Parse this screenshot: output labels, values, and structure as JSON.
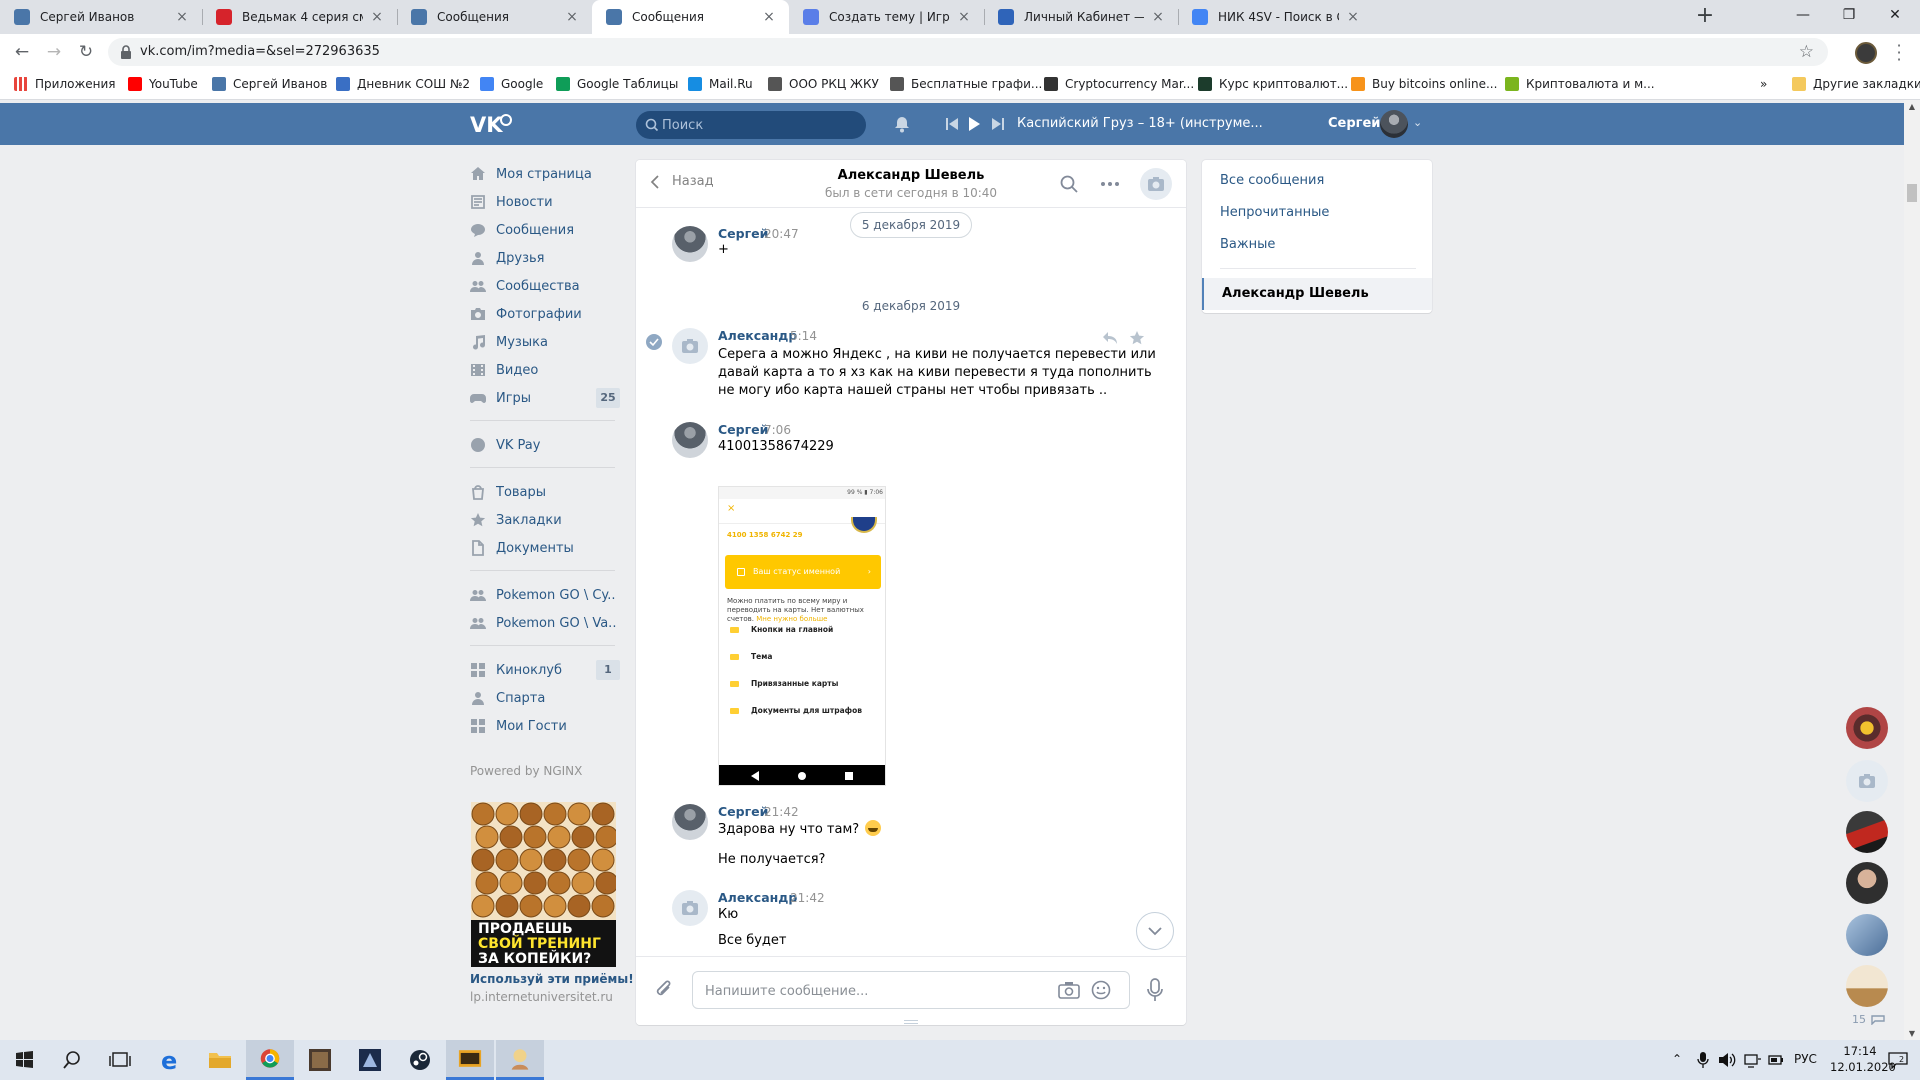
{
  "browser": {
    "tabs": [
      {
        "title": "Сергей Иванов",
        "icon": "vk-icon",
        "color": "#4a76a8"
      },
      {
        "title": "Ведьмак 4 серия смотреть онла",
        "icon": "z-icon",
        "color": "#d6232b"
      },
      {
        "title": "Сообщения",
        "icon": "vk-message-icon",
        "color": "#4a76a8"
      },
      {
        "title": "Сообщения",
        "icon": "vk-message-icon",
        "color": "#4a76a8"
      },
      {
        "title": "Создать тему | Игровое сообще",
        "icon": "s-icon",
        "color": "#5a7ee8"
      },
      {
        "title": "Личный Кабинет — «Скрайд»",
        "icon": "skrayd-icon",
        "color": "#2f64b9"
      },
      {
        "title": "НИК 4SV - Поиск в Google",
        "icon": "google-icon",
        "color": "#4285f4"
      }
    ],
    "active_tab": 3,
    "url": "vk.com/im?media=&sel=272963635",
    "bookmarks": [
      {
        "label": "Приложения",
        "color": "#e8453c"
      },
      {
        "label": "YouTube",
        "color": "#ff0000"
      },
      {
        "label": "Сергей Иванов",
        "color": "#4a76a8"
      },
      {
        "label": "Дневник СОШ №2",
        "color": "#3a6fc4"
      },
      {
        "label": "Google",
        "color": "#4285f4"
      },
      {
        "label": "Google Таблицы",
        "color": "#0f9d58"
      },
      {
        "label": "Mail.Ru",
        "color": "#168de2"
      },
      {
        "label": "ООО РКЦ ЖКУ",
        "color": "#555555"
      },
      {
        "label": "Бесплатные графи...",
        "color": "#555555"
      },
      {
        "label": "Cryptocurrency Mar...",
        "color": "#333333"
      },
      {
        "label": "Курс криптовалют...",
        "color": "#1c3c2c"
      },
      {
        "label": "Buy bitcoins online...",
        "color": "#f7931a"
      },
      {
        "label": "Криптовалюта и м...",
        "color": "#7bb51e"
      }
    ],
    "bookmarks_overflow": "»",
    "other_bookmarks": "Другие закладки"
  },
  "vk_header": {
    "search_placeholder": "Поиск",
    "track": "Каспийский Груз – 18+ (инструме...",
    "user_name": "Сергей"
  },
  "left_nav": {
    "groups": [
      [
        {
          "label": "Моя страница",
          "icon": "home-icon"
        },
        {
          "label": "Новости",
          "icon": "news-icon"
        },
        {
          "label": "Сообщения",
          "icon": "messages-icon"
        },
        {
          "label": "Друзья",
          "icon": "friends-icon"
        },
        {
          "label": "Сообщества",
          "icon": "communities-icon"
        },
        {
          "label": "Фотографии",
          "icon": "photos-icon"
        },
        {
          "label": "Музыка",
          "icon": "music-icon"
        },
        {
          "label": "Видео",
          "icon": "video-icon"
        },
        {
          "label": "Игры",
          "icon": "games-icon",
          "count": "25"
        }
      ],
      [
        {
          "label": "VK Pay",
          "icon": "vkpay-icon"
        }
      ],
      [
        {
          "label": "Товары",
          "icon": "goods-icon"
        },
        {
          "label": "Закладки",
          "icon": "bookmarks-icon"
        },
        {
          "label": "Документы",
          "icon": "documents-icon"
        }
      ],
      [
        {
          "label": "Pokemon GO \\ Cy..",
          "icon": "group-icon"
        },
        {
          "label": "Pokemon GO \\ Va..",
          "icon": "group-icon"
        }
      ],
      [
        {
          "label": "Киноклуб",
          "icon": "app-icon",
          "count": "1"
        },
        {
          "label": "Спарта",
          "icon": "person-icon"
        },
        {
          "label": "Мои Гости",
          "icon": "app-icon"
        }
      ]
    ],
    "powered": "Powered by NGINX",
    "ad": {
      "line1": "ПРОДАЕШЬ",
      "line2": "СВОЙ ТРЕНИНГ",
      "line3": "ЗА КОПЕЙКИ?",
      "title": "Используй эти приёмы!",
      "url": "lp.internetuniversitet.ru"
    }
  },
  "chat": {
    "back_label": "Назад",
    "peer_name": "Александр Шевель",
    "peer_status": "был в сети сегодня в 10:40",
    "date_pill": "5 декабря 2019",
    "date_sep": "6 декабря 2019",
    "messages": [
      {
        "author": "Сергей",
        "time": "20:47",
        "lines": [
          "+"
        ]
      },
      {
        "author": "Александр",
        "time": "5:14",
        "lines": [
          "Серега а можно Яндекс , на киви не получается перевести или",
          "давай карта а то я хз как на киви перевести я туда пополнить",
          "не могу ибо карта нашей страны нет чтобы привязать .."
        ]
      },
      {
        "author": "Сергей",
        "time": "7:06",
        "lines": [
          "41001358674229"
        ]
      },
      {
        "author": "Сергей",
        "time": "21:42",
        "lines": [
          "Здарова ну что там?"
        ],
        "extra": "Не получается?"
      },
      {
        "author": "Александр",
        "time": "21:42",
        "lines": [
          "Кю"
        ],
        "extra": "Все будет"
      }
    ],
    "attachment": {
      "status": "99 % ▮ 7:06",
      "close": "×",
      "account": "4100 1358 6742 29",
      "button": "Ваш статус именной",
      "button_arrow": "›",
      "desc": "Можно платить по всему миру и переводить на карты. Нет валютных счетов.",
      "desc_link": "Мне нужно больше",
      "rows": [
        "Кнопки на главной",
        "Тема",
        "Привязанные карты",
        "Документы для штрафов"
      ]
    },
    "composer_placeholder": "Напишите сообщение..."
  },
  "filters": {
    "items": [
      "Все сообщения",
      "Непрочитанные",
      "Важные"
    ],
    "conversation": "Александр Шевель"
  },
  "right_column": {
    "count": "15"
  },
  "taskbar": {
    "lang": "РУС",
    "time": "17:14",
    "date": "12.01.2020",
    "notifications": "2"
  }
}
